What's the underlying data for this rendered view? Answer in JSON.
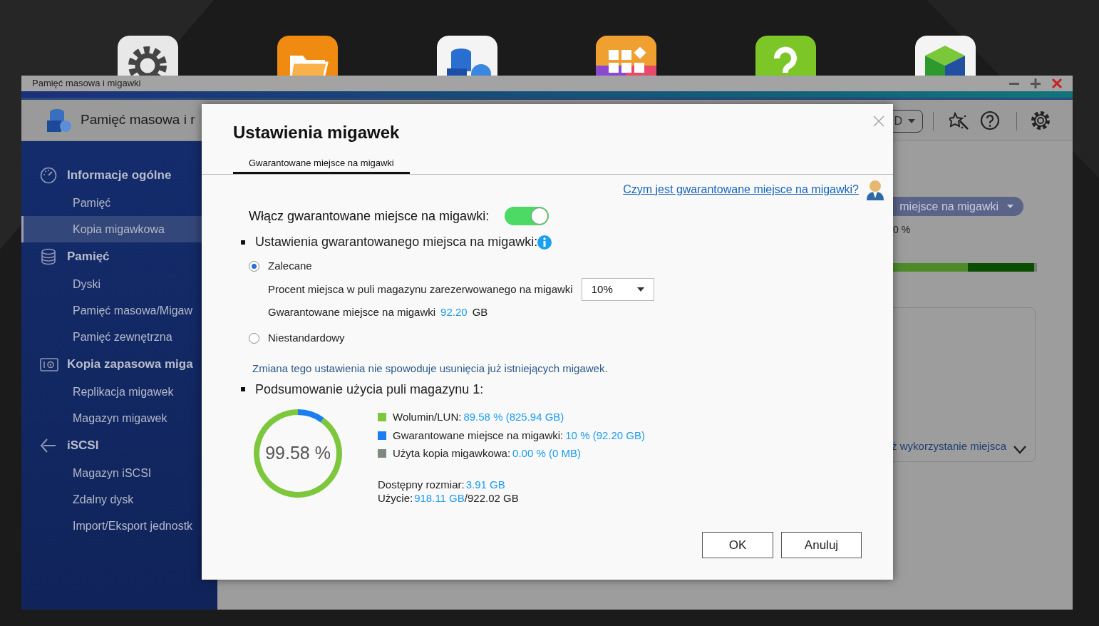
{
  "desktop_icons": [
    {
      "kind": "gear"
    },
    {
      "kind": "folder"
    },
    {
      "kind": "database"
    },
    {
      "kind": "grid"
    },
    {
      "kind": "question"
    },
    {
      "kind": "cube"
    }
  ],
  "window": {
    "title": "Pamięć masowa i migawki",
    "app_title": "Pamięć masowa i r",
    "dropdown_fragment": "D"
  },
  "sidebar": {
    "groups": [
      {
        "kind": "gauge",
        "label": "Informacje ogólne",
        "items": [
          {
            "label": "Pamięć",
            "selected": false
          },
          {
            "label": "Kopia migawkowa",
            "selected": true
          }
        ]
      },
      {
        "kind": "database",
        "label": "Pamięć",
        "items": [
          {
            "label": "Dyski",
            "selected": false
          },
          {
            "label": "Pamięć masowa/Migaw",
            "selected": false
          },
          {
            "label": "Pamięć zewnętrzna",
            "selected": false
          }
        ]
      },
      {
        "kind": "camera",
        "label": "Kopia zapasowa miga",
        "items": [
          {
            "label": "Replikacja migawek",
            "selected": false
          },
          {
            "label": "Magazyn migawek",
            "selected": false
          }
        ]
      },
      {
        "kind": "iscsi",
        "label": "iSCSI",
        "items": [
          {
            "label": "Magazyn iSCSI",
            "selected": false
          },
          {
            "label": "Zdalny dysk",
            "selected": false
          },
          {
            "label": "Import/Eksport jednostk",
            "selected": false
          }
        ]
      }
    ]
  },
  "background": {
    "pill": "miejsce na migawki",
    "percent": "0 %",
    "bar": {
      "level": 0.98
    },
    "card_link": "ż wykorzystanie miejsca"
  },
  "dialog": {
    "title": "Ustawienia migawek",
    "tabs": [
      {
        "label": "Gwarantowane miejsce na migawki",
        "selected": true
      }
    ],
    "help_link": "Czym jest gwarantowane miejsce na migawki?",
    "enable": {
      "label": "Włącz gwarantowane miejsce na migawki:",
      "on": true
    },
    "settings_heading": "Ustawienia gwarantowanego miejsca na migawki:",
    "options": [
      {
        "label": "Zalecane",
        "selected": true
      },
      {
        "label": "Niestandardowy",
        "selected": false
      }
    ],
    "percent": {
      "label": "Procent miejsca w puli magazynu zarezerwowanego na migawki",
      "value": "10%"
    },
    "guaranteed": {
      "label": "Gwarantowane miejsce na migawki",
      "value": "92.20",
      "unit": "GB"
    },
    "note": "Zmiana tego ustawienia nie spowoduje usunięcia już istniejących migawek.",
    "summary_heading": "Podsumowanie użycia puli magazynu 1:",
    "ring": {
      "center": "99.58 %",
      "chart_data": {
        "type": "donut",
        "values": [
          89.58,
          10,
          0
        ]
      }
    },
    "legend": [
      {
        "label": "Wolumin/LUN:",
        "value": "89.58 % (825.94 GB)",
        "color": "#7dc73d"
      },
      {
        "label": "Gwarantowane miejsce na migawki:",
        "value": "10 % (92.20 GB)",
        "color": "#1a7df0"
      },
      {
        "label": "Użyta kopia migawkowa:",
        "value": "0.00 % (0 MB)",
        "color": "#7c8a80"
      }
    ],
    "available": {
      "label": "Dostępny rozmiar:",
      "value": "3.91 GB"
    },
    "usage": {
      "label": "Użycie:",
      "value": "918.11 GB",
      "total": "/922.02 GB"
    },
    "buttons": [
      "OK",
      "Anuluj"
    ]
  }
}
